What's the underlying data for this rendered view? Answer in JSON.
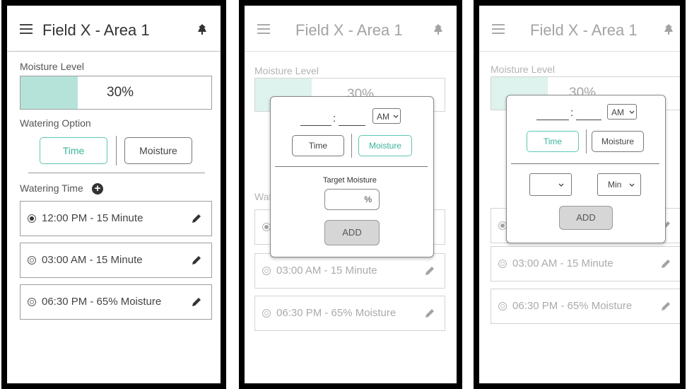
{
  "header": {
    "title": "Field X - Area 1"
  },
  "moisture": {
    "label": "Moisture Level",
    "value_text": "30%",
    "level_percent": 30,
    "fill_color": "#b5e3da"
  },
  "watering_option": {
    "label": "Watering Option",
    "time_label": "Time",
    "moisture_label": "Moisture"
  },
  "watering_time": {
    "label": "Watering Time",
    "items": [
      {
        "text": "12:00 PM - 15 Minute",
        "selected": true
      },
      {
        "text": "03:00 AM - 15 Minute",
        "selected": false
      },
      {
        "text": "06:30 PM - 65% Moisture",
        "selected": false
      }
    ]
  },
  "modal_moisture": {
    "colon": ":",
    "ampm": "AM",
    "time_label": "Time",
    "moisture_label": "Moisture",
    "target_label": "Target Moisture",
    "percent_unit": "%",
    "add_label": "ADD"
  },
  "modal_time": {
    "colon": ":",
    "ampm": "AM",
    "time_label": "Time",
    "moisture_label": "Moisture",
    "min_label": "Min",
    "add_label": "ADD"
  },
  "colors": {
    "accent": "#3bb39b",
    "fill": "#b5e3da"
  }
}
